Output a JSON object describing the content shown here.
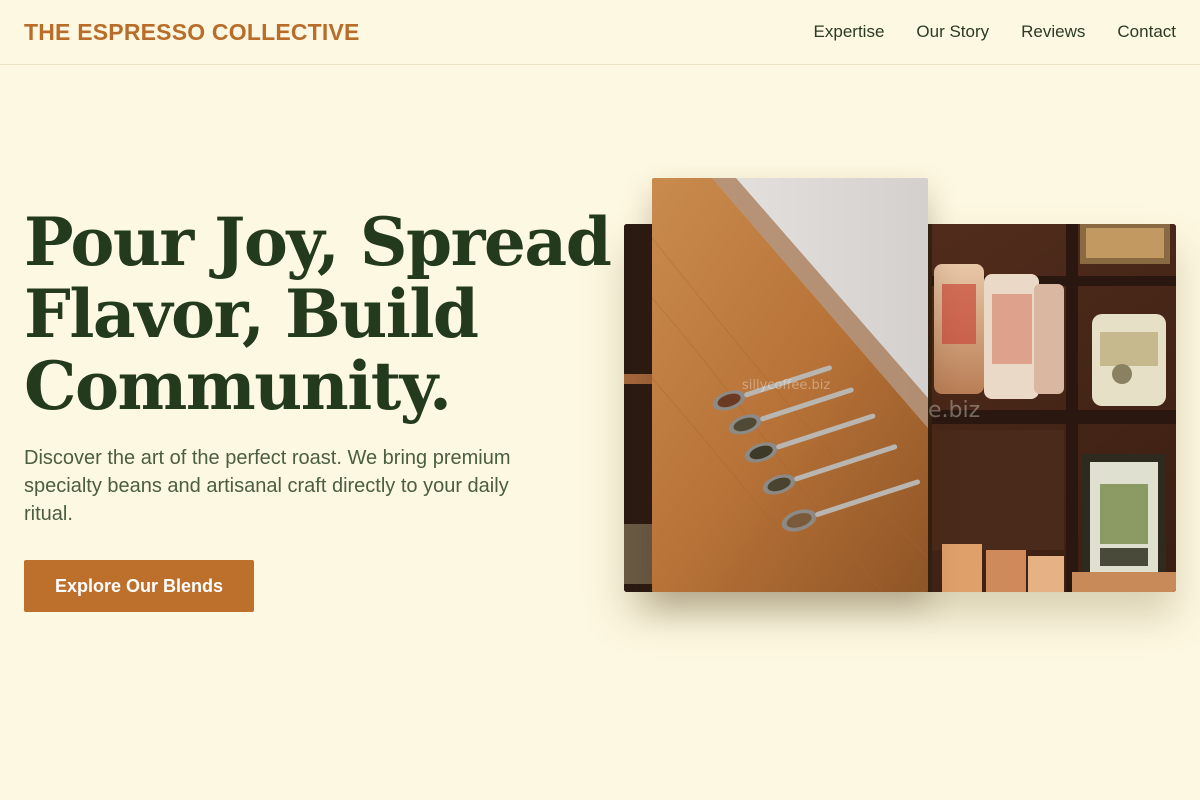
{
  "header": {
    "brand": "THE ESPRESSO COLLECTIVE",
    "nav": [
      {
        "label": "Expertise"
      },
      {
        "label": "Our Story"
      },
      {
        "label": "Reviews"
      },
      {
        "label": "Contact"
      }
    ]
  },
  "hero": {
    "title_lines": [
      "Pour Joy, Spread",
      "Flavor, Build",
      "Community."
    ],
    "lead": "Discover the art of the perfect roast. We bring premium specialty beans and artisanal craft directly to your daily ritual.",
    "cta_label": "Explore Our Blends"
  },
  "images": {
    "front_watermark": "sillycoffee.biz",
    "back_watermark": "e.biz"
  },
  "colors": {
    "background": "#fdf8e1",
    "brand": "#b86d2b",
    "heading": "#243a1d",
    "cta": "#bd6f2c"
  }
}
